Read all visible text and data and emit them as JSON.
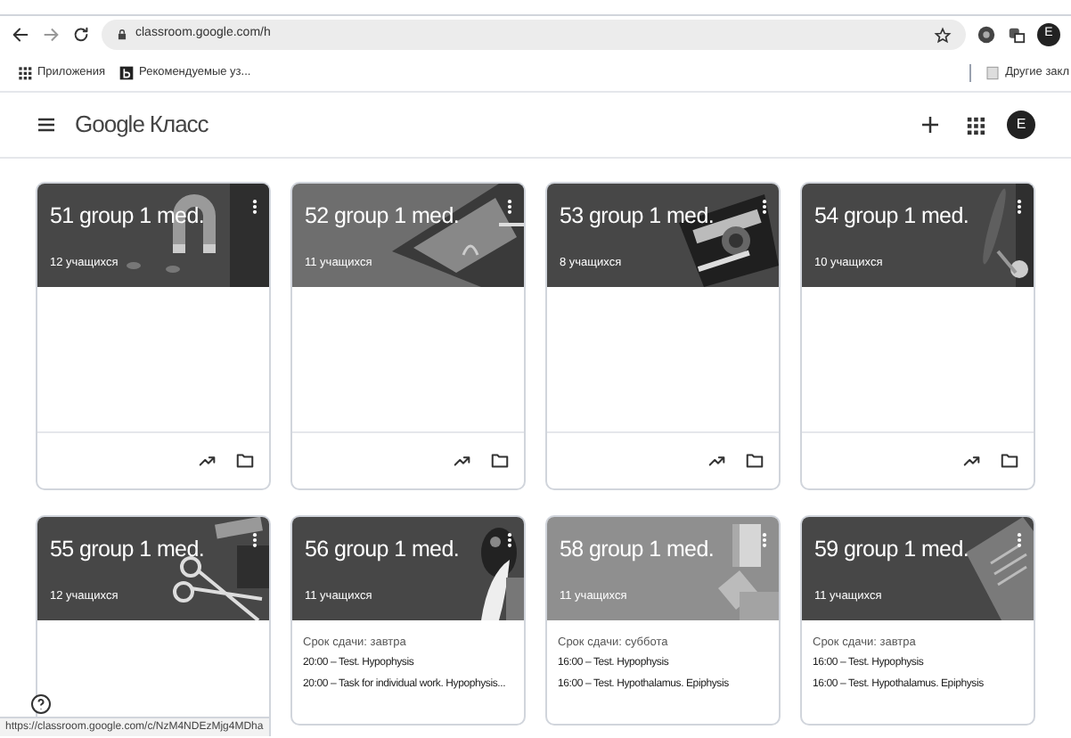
{
  "browser": {
    "url": "classroom.google.com/h",
    "avatar": "E",
    "bookmarks": [
      {
        "label": "Приложения",
        "kind": "apps"
      },
      {
        "label": "Рекомендуемые уз...",
        "kind": "site"
      }
    ],
    "other_bookmarks": "Другие закл"
  },
  "app": {
    "logo_google": "Google",
    "logo_product": "Класс",
    "avatar": "E"
  },
  "cards": [
    {
      "title": "51 group 1 med.",
      "students": "12 учащихся",
      "footer_shown": true
    },
    {
      "title": "52 group 1 med.",
      "students": "11 учащихся",
      "footer_shown": true
    },
    {
      "title": "53 group 1 med.",
      "students": "8 учащихся",
      "footer_shown": true
    },
    {
      "title": "54 group 1 med.",
      "students": "10 учащихся",
      "footer_shown": true
    },
    {
      "title": "55 group 1 med.",
      "students": "12 учащихся",
      "footer_shown": false
    },
    {
      "title": "56 group 1 med.",
      "students": "11 учащихся",
      "footer_shown": false,
      "due": "Срок сдачи: завтра",
      "assignments": [
        "20:00 – Test. Hypophysis",
        "20:00 – Task for individual work. Hypophysis..."
      ]
    },
    {
      "title": "58 group 1 med.",
      "students": "11 учащихся",
      "footer_shown": false,
      "due": "Срок сдачи: суббота",
      "assignments": [
        "16:00 – Test. Hypophysis",
        "16:00 – Test. Hypothalamus. Epiphysis"
      ]
    },
    {
      "title": "59 group 1 med.",
      "students": "11 учащихся",
      "footer_shown": false,
      "due": "Срок сдачи: завтра",
      "assignments": [
        "16:00 – Test. Hypophysis",
        "16:00 – Test. Hypothalamus. Epiphysis"
      ]
    }
  ],
  "status_link": "https://classroom.google.com/c/NzM4NDEzMjg4MDha"
}
